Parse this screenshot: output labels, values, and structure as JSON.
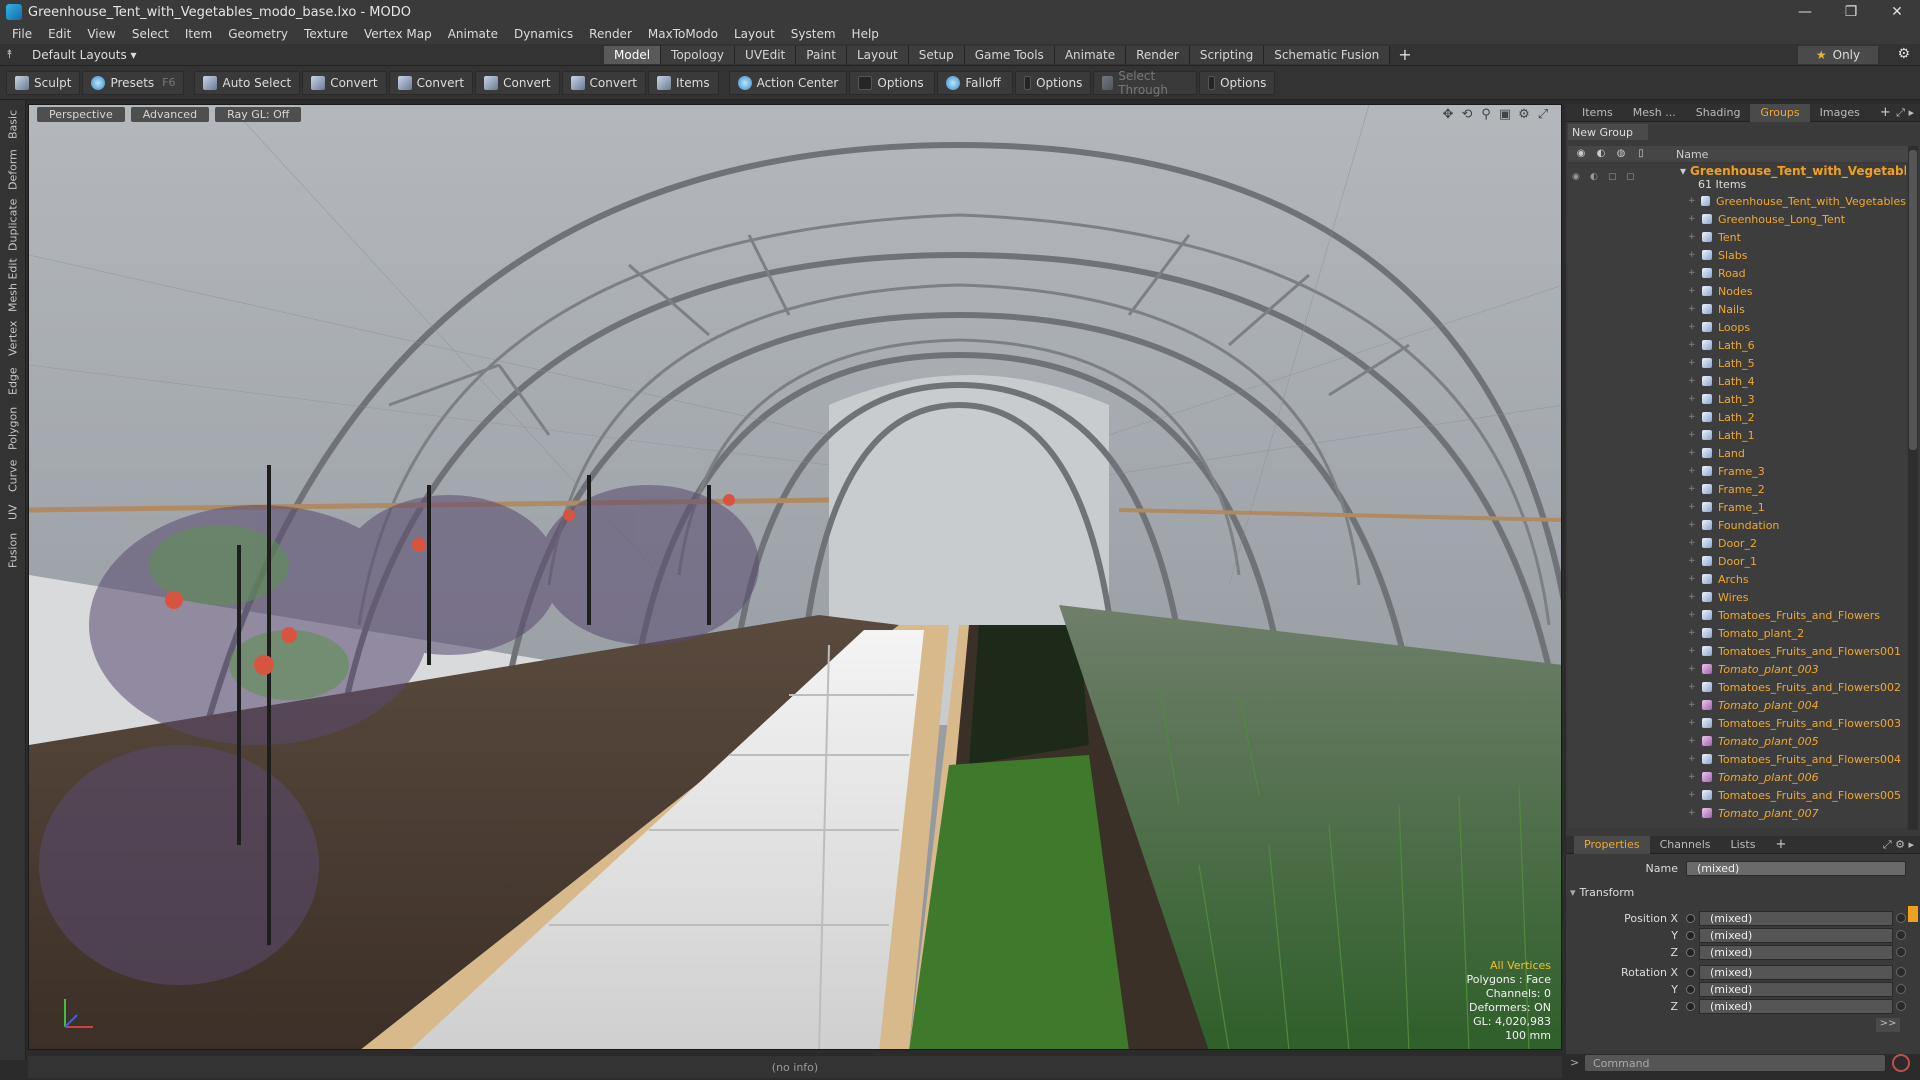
{
  "window": {
    "title": "Greenhouse_Tent_with_Vegetables_modo_base.lxo - MODO"
  },
  "menu": [
    "File",
    "Edit",
    "View",
    "Select",
    "Item",
    "Geometry",
    "Texture",
    "Vertex Map",
    "Animate",
    "Dynamics",
    "Render",
    "MaxToModo",
    "Layout",
    "System",
    "Help"
  ],
  "layouts": {
    "default_label": "Default Layouts ▾",
    "tabs": [
      "Model",
      "Topology",
      "UVEdit",
      "Paint",
      "Layout",
      "Setup",
      "Game Tools",
      "Animate",
      "Render",
      "Scripting",
      "Schematic Fusion"
    ],
    "active": "Model",
    "only_label": "Only"
  },
  "toolbar": {
    "sculpt": "Sculpt",
    "presets": "Presets",
    "presets_key": "F6",
    "auto_select": "Auto Select",
    "convert1": "Convert",
    "convert2": "Convert",
    "convert3": "Convert",
    "convert4": "Convert",
    "items": "Items",
    "action_center": "Action Center",
    "options1": "Options",
    "falloff": "Falloff",
    "options2": "Options",
    "select_through": "Select Through",
    "options3": "Options"
  },
  "left_tabs": [
    "Basic",
    "Deform",
    "Duplicate",
    "Mesh Edit",
    "Vertex",
    "Edge",
    "Polygon",
    "Curve",
    "UV",
    "Fusion"
  ],
  "viewport": {
    "view_mode": "Perspective",
    "shading": "Advanced",
    "raygl": "Ray GL: Off",
    "stats": {
      "all_vertices": "All Vertices",
      "polygons": "Polygons : Face",
      "channels": "Channels: 0",
      "deformers": "Deformers: ON",
      "gl": "GL: 4,020,983",
      "scale": "100 mm"
    }
  },
  "groups_panel": {
    "tabs": [
      "Items",
      "Mesh ...",
      "Shading",
      "Groups",
      "Images"
    ],
    "active": "Groups",
    "new_group": "New Group",
    "name_header": "Name",
    "root": "Greenhouse_Tent_with_Vegetabl ...",
    "count": "61 Items",
    "items": [
      {
        "name": "Greenhouse_Tent_with_Vegetables",
        "italic": false
      },
      {
        "name": "Greenhouse_Long_Tent",
        "italic": false
      },
      {
        "name": "Tent",
        "italic": false
      },
      {
        "name": "Slabs",
        "italic": false
      },
      {
        "name": "Road",
        "italic": false
      },
      {
        "name": "Nodes",
        "italic": false
      },
      {
        "name": "Nails",
        "italic": false
      },
      {
        "name": "Loops",
        "italic": false
      },
      {
        "name": "Lath_6",
        "italic": false
      },
      {
        "name": "Lath_5",
        "italic": false
      },
      {
        "name": "Lath_4",
        "italic": false
      },
      {
        "name": "Lath_3",
        "italic": false
      },
      {
        "name": "Lath_2",
        "italic": false
      },
      {
        "name": "Lath_1",
        "italic": false
      },
      {
        "name": "Land",
        "italic": false
      },
      {
        "name": "Frame_3",
        "italic": false
      },
      {
        "name": "Frame_2",
        "italic": false
      },
      {
        "name": "Frame_1",
        "italic": false
      },
      {
        "name": "Foundation",
        "italic": false
      },
      {
        "name": "Door_2",
        "italic": false
      },
      {
        "name": "Door_1",
        "italic": false
      },
      {
        "name": "Archs",
        "italic": false
      },
      {
        "name": "Wires",
        "italic": false
      },
      {
        "name": "Tomatoes_Fruits_and_Flowers",
        "italic": false
      },
      {
        "name": "Tomato_plant_2",
        "italic": false
      },
      {
        "name": "Tomatoes_Fruits_and_Flowers001",
        "italic": false
      },
      {
        "name": "Tomato_plant_003",
        "italic": true
      },
      {
        "name": "Tomatoes_Fruits_and_Flowers002",
        "italic": false
      },
      {
        "name": "Tomato_plant_004",
        "italic": true
      },
      {
        "name": "Tomatoes_Fruits_and_Flowers003",
        "italic": false
      },
      {
        "name": "Tomato_plant_005",
        "italic": true
      },
      {
        "name": "Tomatoes_Fruits_and_Flowers004",
        "italic": false
      },
      {
        "name": "Tomato_plant_006",
        "italic": true
      },
      {
        "name": "Tomatoes_Fruits_and_Flowers005",
        "italic": false
      },
      {
        "name": "Tomato_plant_007",
        "italic": true
      }
    ]
  },
  "properties": {
    "tabs": [
      "Properties",
      "Channels",
      "Lists"
    ],
    "active": "Properties",
    "name_label": "Name",
    "name_value": "(mixed)",
    "section": "Transform",
    "position_x_label": "Position X",
    "y_label": "Y",
    "z_label": "Z",
    "rotation_x_label": "Rotation X",
    "mixed": "(mixed)",
    "more": ">>"
  },
  "command": {
    "placeholder": "Command"
  },
  "status": {
    "info": "(no info)"
  },
  "colors": {
    "accent": "#f0a830",
    "active_tab": "#5a5a5a",
    "panel": "#3a3a3a"
  }
}
